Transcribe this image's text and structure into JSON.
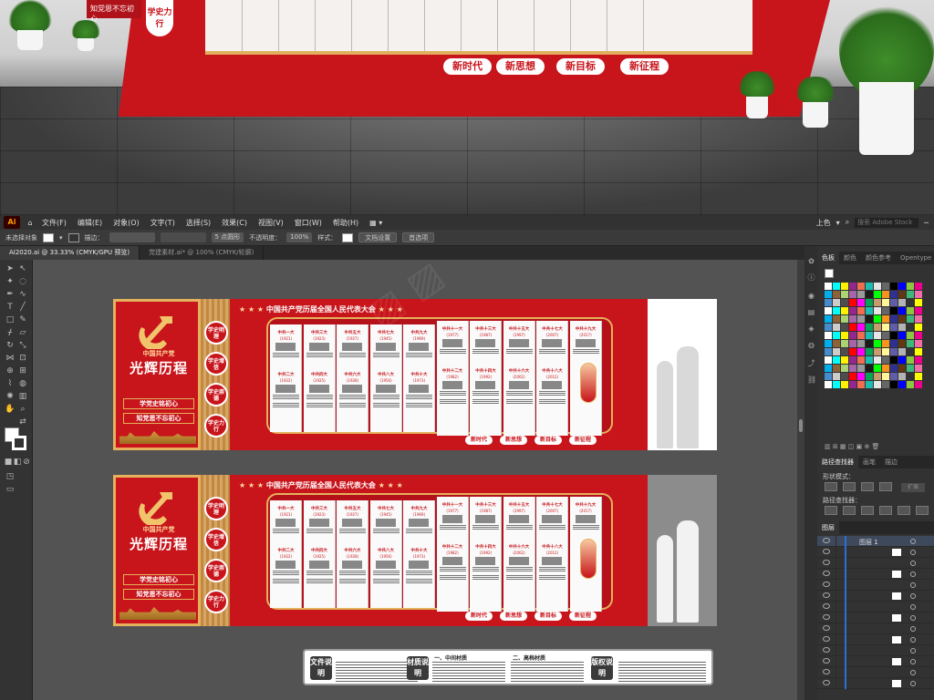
{
  "render": {
    "pills": [
      "新时代",
      "新思想",
      "新目标",
      "新征程"
    ],
    "badge": "学史力行",
    "topleft": "知党恩不忘初心"
  },
  "menubar": {
    "logo": "Ai",
    "items": [
      "文件(F)",
      "编辑(E)",
      "对象(O)",
      "文字(T)",
      "选择(S)",
      "效果(C)",
      "视图(V)",
      "窗口(W)",
      "帮助(H)"
    ],
    "workspace": "上色",
    "search_placeholder": "搜索 Adobe Stock"
  },
  "controlbar": {
    "selection": "未选择对象",
    "stroke_label": "描边：",
    "brush": "5 点圆形",
    "opacity_label": "不透明度：",
    "opacity": "100%",
    "style_label": "样式：",
    "doc_setup": "文档设置",
    "prefs": "首选项"
  },
  "tabs": [
    {
      "label": "AI2020.ai @ 33.33% (CMYK/GPU 预览)",
      "active": true
    },
    {
      "label": "党建素材.ai* @ 100% (CMYK/轮廓)",
      "active": false
    }
  ],
  "artwork": {
    "sub": "中国共产党",
    "title": "光辉历程",
    "line1": "学党史铭初心",
    "line2": "知党恩不忘初心",
    "circles": [
      "学史明理",
      "学史增信",
      "学史崇德",
      "学史力行"
    ],
    "header": "中国共产党历届全国人民代表大会",
    "header_stars": "★ ★ ★",
    "columns_top": [
      "中共一大",
      "中共三大",
      "中共五大",
      "中共七大",
      "中共九大",
      "中共十一大",
      "中共十三大",
      "中共十五大",
      "中共十七大",
      "中共十九大"
    ],
    "years_top": [
      "(1921)",
      "(1923)",
      "(1927)",
      "(1945)",
      "(1969)",
      "(1977)",
      "(1987)",
      "(1997)",
      "(2007)",
      "(2017)"
    ],
    "columns_bottom": [
      "中共二大",
      "中共四大",
      "中共六大",
      "中共八大",
      "中共十大",
      "中共十二大",
      "中共十四大",
      "中共十六大",
      "中共十八大"
    ],
    "years_bottom": [
      "(1922)",
      "(1925)",
      "(1928)",
      "(1956)",
      "(1973)",
      "(1982)",
      "(1992)",
      "(2002)",
      "(2012)"
    ],
    "bottom_pills": [
      "新时代",
      "新思想",
      "新目标",
      "新征程"
    ]
  },
  "legend": {
    "boxes": [
      "文件说明",
      "材质说明",
      "版权说明"
    ],
    "titles": [
      "一、中间材质",
      "二、高档材质"
    ]
  },
  "panels": {
    "top_tabs": [
      "色板",
      "颜色",
      "颜色参考",
      "Opentype"
    ],
    "pathfinder_tabs": [
      "路径查找器",
      "画笔",
      "描边"
    ],
    "shape_modes": "形状模式：",
    "pathfinders": "路径查找器：",
    "expand": "扩展",
    "layers_tab": "图层",
    "layer_name": "图层 1"
  },
  "colors": {
    "red": "#c8141b",
    "gold": "#e5b15c",
    "ui_dark": "#323232",
    "canvas": "#535353"
  }
}
